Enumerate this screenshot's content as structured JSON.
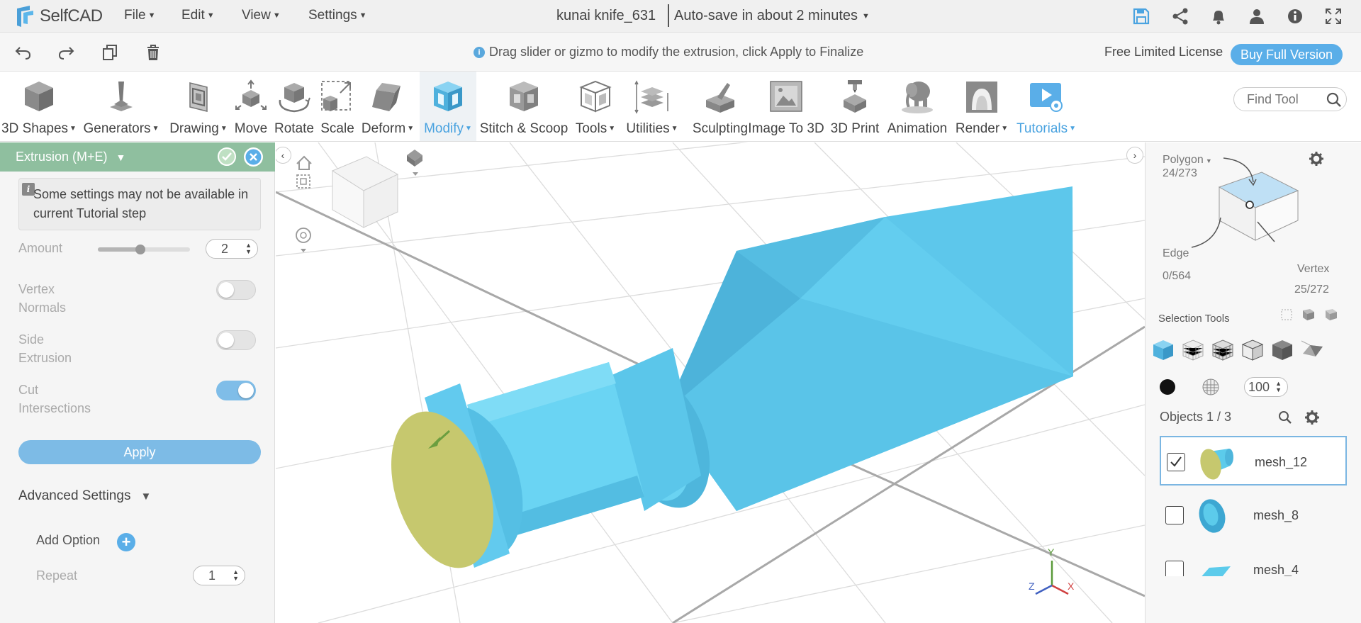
{
  "app": {
    "name": "SelfCAD"
  },
  "menu": {
    "file": "File",
    "edit": "Edit",
    "view": "View",
    "settings": "Settings"
  },
  "document": {
    "title": "kunai knife_631",
    "autosave": "Auto-save in about 2 minutes"
  },
  "hint": "Drag slider or gizmo to modify the extrusion, click Apply to Finalize",
  "license": {
    "text": "Free Limited License",
    "buy": "Buy Full Version"
  },
  "toolbar": {
    "shapes": "3D Shapes",
    "generators": "Generators",
    "drawing": "Drawing",
    "move": "Move",
    "rotate": "Rotate",
    "scale": "Scale",
    "deform": "Deform",
    "modify": "Modify",
    "stitch": "Stitch & Scoop",
    "tools": "Tools",
    "utilities": "Utilities",
    "sculpting": "Sculpting",
    "image_to_3d": "Image To 3D",
    "print": "3D Print",
    "animation": "Animation",
    "render": "Render",
    "tutorials": "Tutorials",
    "find_placeholder": "Find Tool"
  },
  "panel": {
    "title": "Extrusion (M+E)",
    "notice": "Some settings may not be available in current Tutorial step",
    "amount_label": "Amount",
    "amount_value": "2",
    "amount_slider": 0.46,
    "vertex_normals": "Vertex Normals",
    "vertex_normals_on": false,
    "side_extrusion": "Side Extrusion",
    "side_extrusion_on": false,
    "cut_intersections": "Cut Intersections",
    "cut_intersections_on": true,
    "apply": "Apply",
    "advanced": "Advanced Settings",
    "add_option": "Add Option",
    "repeat_label": "Repeat",
    "repeat_value": "1"
  },
  "axes": {
    "x": "X",
    "y": "Y",
    "z": "Z"
  },
  "selection": {
    "polygon_label": "Polygon",
    "polygon_count": "24/273",
    "edge_label": "Edge",
    "edge_count": "0/564",
    "vertex_label": "Vertex",
    "vertex_count": "25/272",
    "tools_label": "Selection Tools",
    "opacity_value": "100"
  },
  "objects": {
    "header": "Objects 1 / 3",
    "items": [
      {
        "name": "mesh_12",
        "checked": true
      },
      {
        "name": "mesh_8",
        "checked": false
      },
      {
        "name": "mesh_4",
        "checked": false
      }
    ]
  },
  "colors": {
    "accent": "#5aaee8",
    "panel_header": "#8fbf9f",
    "model": "#5ccbeb",
    "face": "#c6c86e"
  }
}
